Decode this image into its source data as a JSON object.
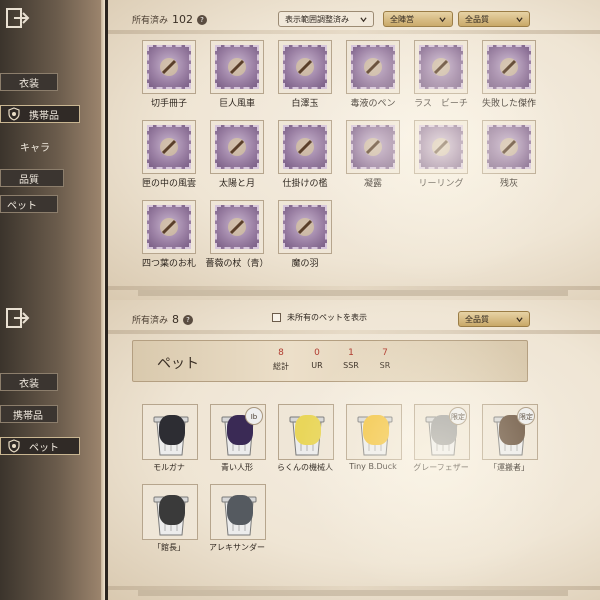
{
  "top": {
    "sidebar": {
      "items": [
        {
          "label": "衣装"
        },
        {
          "label": "携帯品"
        },
        {
          "label": "キャラ"
        },
        {
          "label": "品質"
        },
        {
          "label": "ペット"
        }
      ]
    },
    "header": {
      "owned_label": "所有済み",
      "owned_count": "102",
      "filter_range": "表示範囲調整済み",
      "filter_camp": "全陣営",
      "filter_quality": "全品質"
    },
    "items": [
      {
        "name": "切手冊子",
        "icon": "stamp-book-icon"
      },
      {
        "name": "巨人風車",
        "icon": "windmill-icon"
      },
      {
        "name": "白澤玉",
        "icon": "white-beast-icon"
      },
      {
        "name": "毒液のペン",
        "icon": "pen-icon"
      },
      {
        "name": "ラス　ビーチ",
        "icon": "candy-icon"
      },
      {
        "name": "失敗した傑作",
        "icon": "doll-icon"
      },
      {
        "name": "匣の中の風雲",
        "icon": "box-icon"
      },
      {
        "name": "太陽と月",
        "icon": "sun-moon-key-icon"
      },
      {
        "name": "仕掛けの檻",
        "icon": "cage-icon"
      },
      {
        "name": "凝露",
        "icon": "dew-orb-icon"
      },
      {
        "name": "リーリング",
        "icon": "ring-icon"
      },
      {
        "name": "残灰",
        "icon": "staff-icon"
      },
      {
        "name": "四つ葉のお札",
        "icon": "clover-icon"
      },
      {
        "name": "薔薇の杖（青）",
        "icon": "rose-cane-icon"
      },
      {
        "name": "魔の羽",
        "icon": "feather-icon"
      }
    ]
  },
  "bottom": {
    "sidebar": {
      "items": [
        {
          "label": "衣装"
        },
        {
          "label": "携帯品"
        },
        {
          "label": "ペット"
        }
      ]
    },
    "header": {
      "owned_label": "所有済み",
      "owned_count": "8",
      "show_unowned": "未所有のペットを表示",
      "filter_quality": "全品質"
    },
    "banner": {
      "title": "ペット",
      "stats": [
        {
          "value": "8",
          "label": "総計"
        },
        {
          "value": "0",
          "label": "UR"
        },
        {
          "value": "1",
          "label": "SSR"
        },
        {
          "value": "7",
          "label": "SR"
        }
      ]
    },
    "pets": [
      {
        "name": "モルガナ",
        "icon": "cat-icon",
        "badge": "",
        "color": "#2d2d33"
      },
      {
        "name": "青い人形",
        "icon": "doll-icon",
        "badge": "Ib",
        "color": "#3a2a55"
      },
      {
        "name": "らくんの機械人",
        "icon": "robot-icon",
        "badge": "",
        "color": "#e9d65a"
      },
      {
        "name": "Tiny B.Duck",
        "icon": "duck-icon",
        "badge": "",
        "color": "#f2c23a"
      },
      {
        "name": "グレーフェザー",
        "icon": "owl-icon",
        "badge": "限定",
        "color": "#9a9a9a"
      },
      {
        "name": "「運搬者」",
        "icon": "creature-icon",
        "badge": "限定",
        "color": "#6b5440"
      },
      {
        "name": "「館長」",
        "icon": "penguin-icon",
        "badge": "",
        "color": "#3a3a3a"
      },
      {
        "name": "アレキサンダー",
        "icon": "bird-icon",
        "badge": "",
        "color": "#555a60"
      }
    ]
  },
  "colors": {
    "stamp_purple": "#9a7fa3",
    "stat_red": "#b03a2e",
    "gold_dropdown": "#c9a868"
  }
}
